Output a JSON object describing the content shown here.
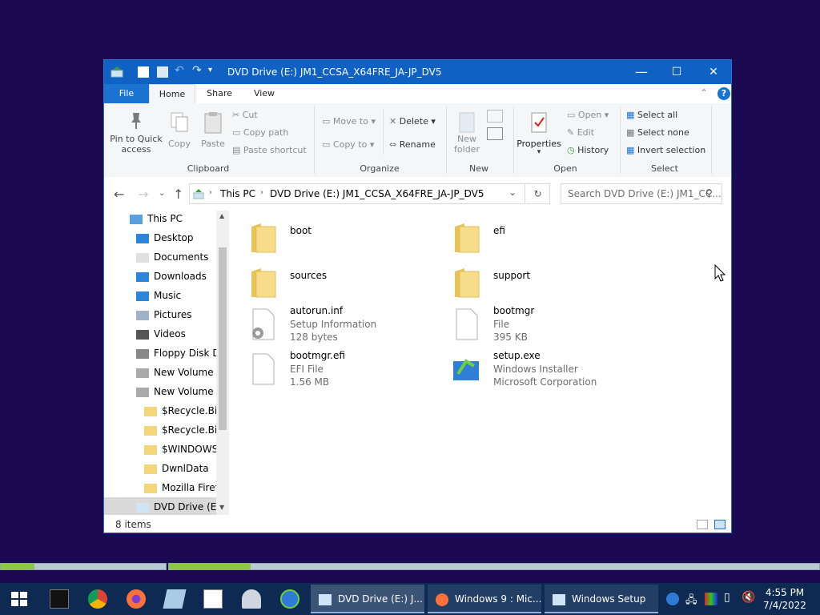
{
  "window": {
    "title": "DVD Drive (E:) JM1_CCSA_X64FRE_JA-JP_DV5",
    "minimize": "—",
    "maximize": "☐",
    "close": "✕"
  },
  "ribbon_tabs": [
    "File",
    "Home",
    "Share",
    "View"
  ],
  "ribbon": {
    "clipboard": {
      "title": "Clipboard",
      "pin_label_1": "Pin to Quick",
      "pin_label_2": "access",
      "copy": "Copy",
      "paste": "Paste",
      "cut": "Cut",
      "copy_path": "Copy path",
      "paste_shortcut": "Paste shortcut"
    },
    "organize": {
      "title": "Organize",
      "move_to": "Move to",
      "copy_to": "Copy to",
      "delete": "Delete",
      "rename": "Rename"
    },
    "new": {
      "title": "New",
      "new_folder_1": "New",
      "new_folder_2": "folder"
    },
    "open": {
      "title": "Open",
      "properties": "Properties",
      "open": "Open",
      "edit": "Edit",
      "history": "History"
    },
    "select": {
      "title": "Select",
      "select_all": "Select all",
      "select_none": "Select none",
      "invert": "Invert selection"
    }
  },
  "address": {
    "crumbs": [
      "This PC",
      "DVD Drive (E:) JM1_CCSA_X64FRE_JA-JP_DV5"
    ],
    "search_placeholder": "Search DVD Drive (E:) JM1_CC..."
  },
  "nav": [
    {
      "label": "This PC",
      "icon": "pc-icon"
    },
    {
      "label": "Desktop",
      "icon": "desktop-icon"
    },
    {
      "label": "Documents",
      "icon": "documents-icon"
    },
    {
      "label": "Downloads",
      "icon": "downloads-icon"
    },
    {
      "label": "Music",
      "icon": "music-icon"
    },
    {
      "label": "Pictures",
      "icon": "pictures-icon"
    },
    {
      "label": "Videos",
      "icon": "videos-icon"
    },
    {
      "label": "Floppy Disk Dri",
      "icon": "floppy-icon"
    },
    {
      "label": "New Volume (C",
      "icon": "drive-icon"
    },
    {
      "label": "New Volume (D",
      "icon": "drive-icon"
    },
    {
      "label": "$Recycle.Bin",
      "icon": "folder-icon"
    },
    {
      "label": "$Recycle.Bin.",
      "icon": "folder-icon"
    },
    {
      "label": "$WINDOWS.~",
      "icon": "folder-icon"
    },
    {
      "label": "DwnlData",
      "icon": "folder-icon"
    },
    {
      "label": "Mozilla Firefo",
      "icon": "folder-icon"
    },
    {
      "label": "DVD Drive (E:) .",
      "icon": "dvd-icon"
    }
  ],
  "files": [
    {
      "name": "boot",
      "type": "folder"
    },
    {
      "name": "efi",
      "type": "folder"
    },
    {
      "name": "sources",
      "type": "folder"
    },
    {
      "name": "support",
      "type": "folder"
    },
    {
      "name": "autorun.inf",
      "line2": "Setup Information",
      "line3": "128 bytes",
      "type": "settings-file"
    },
    {
      "name": "bootmgr",
      "line2": "File",
      "line3": "395 KB",
      "type": "file"
    },
    {
      "name": "bootmgr.efi",
      "line2": "EFI File",
      "line3": "1.56 MB",
      "type": "file"
    },
    {
      "name": "setup.exe",
      "line2": "Windows Installer",
      "line3": "Microsoft Corporation",
      "type": "setup"
    }
  ],
  "status": {
    "item_count": "8 items"
  },
  "taskbar": {
    "tasks": [
      "DVD Drive (E:) J...",
      "Windows 9 : Mic...",
      "Windows Setup"
    ],
    "time": "4:55 PM",
    "date": "7/4/2022"
  },
  "progress": [
    0.205,
    0.125
  ],
  "colors": {
    "accent": "#0f62c3",
    "desktop": "#1b0a52",
    "taskbar": "#0e2a52",
    "progress": "#8dc63f"
  }
}
